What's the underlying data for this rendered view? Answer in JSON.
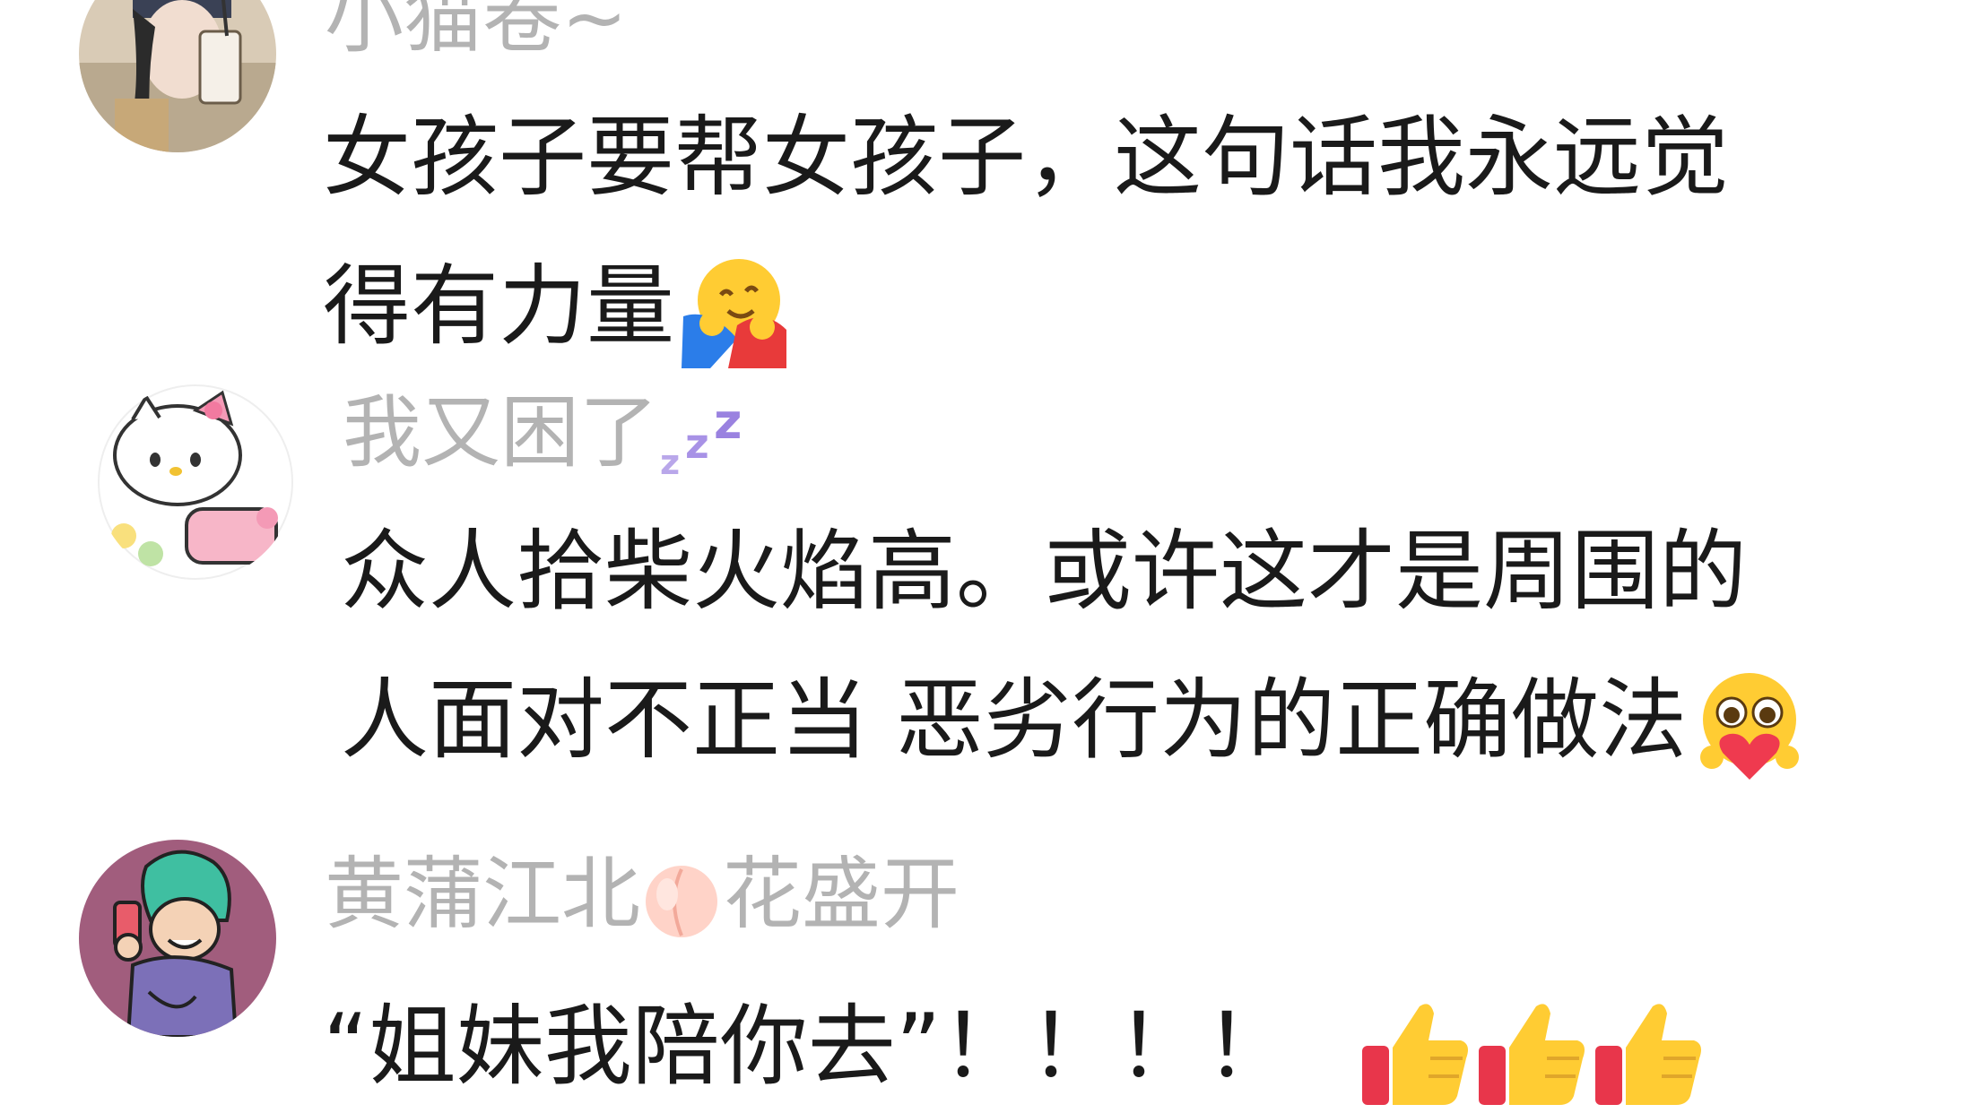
{
  "comments": [
    {
      "username": "小猫卷~",
      "avatar": "avatar-girl-with-drink",
      "lines": [
        "女孩子要帮女孩子，这句话我永远觉",
        "得有力量"
      ],
      "trailing_emoji": "hugging-face-emoji"
    },
    {
      "username": "我又困了",
      "username_emoji": "zzz-sleep-emoji",
      "avatar": "avatar-hello-kitty",
      "lines": [
        "众人拾柴火焰高。或许这才是周围的",
        "人面对不正当 恶劣行为的正确做法"
      ],
      "trailing_emoji": "pleading-heart-face-emoji"
    },
    {
      "username_part1": "黄蒲江北",
      "username_emoji": "peach-emoji",
      "username_part2": "花盛开",
      "avatar": "avatar-cartoon-girl-phone",
      "lines": [
        "“姐妹我陪你去”！！！！"
      ],
      "trailing_emoji": "thumbs-up-emoji",
      "trailing_emoji_count": 3
    }
  ],
  "colors": {
    "username": "#b3b3b3",
    "text": "#1a1a1a",
    "background": "#ffffff"
  }
}
